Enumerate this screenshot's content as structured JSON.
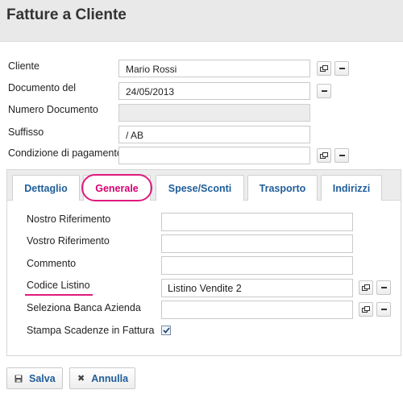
{
  "page": {
    "title": "Fatture a Cliente"
  },
  "form": {
    "cliente": {
      "label": "Cliente",
      "value": "Mario Rossi"
    },
    "documento_del": {
      "label": "Documento del",
      "value": "24/05/2013"
    },
    "numero_documento": {
      "label": "Numero Documento",
      "value": ""
    },
    "suffisso": {
      "label": "Suffisso",
      "value": "/ AB"
    },
    "condizione_pagamento": {
      "label": "Condizione di pagamento",
      "value": ""
    }
  },
  "tabs": [
    {
      "label": "Dettaglio",
      "active": false
    },
    {
      "label": "Generale",
      "active": true
    },
    {
      "label": "Spese/Sconti",
      "active": false
    },
    {
      "label": "Trasporto",
      "active": false
    },
    {
      "label": "Indirizzi",
      "active": false
    }
  ],
  "generale": {
    "nostro_riferimento": {
      "label": "Nostro Riferimento",
      "value": ""
    },
    "vostro_riferimento": {
      "label": "Vostro Riferimento",
      "value": ""
    },
    "commento": {
      "label": "Commento",
      "value": ""
    },
    "codice_listino": {
      "label": "Codice Listino",
      "value": "Listino Vendite 2"
    },
    "banca_azienda": {
      "label": "Seleziona Banca Azienda",
      "value": ""
    },
    "stampa_scadenze": {
      "label": "Stampa Scadenze in Fattura",
      "checked": true
    }
  },
  "actions": {
    "save_label": "Salva",
    "cancel_label": "Annulla"
  },
  "colors": {
    "accent": "#1f5d9a",
    "highlight": "#e0197d"
  },
  "icons": {
    "lookup": "open-lookup-icon",
    "clear": "minus-icon",
    "save": "floppy-disk-icon",
    "cancel": "close-icon"
  }
}
